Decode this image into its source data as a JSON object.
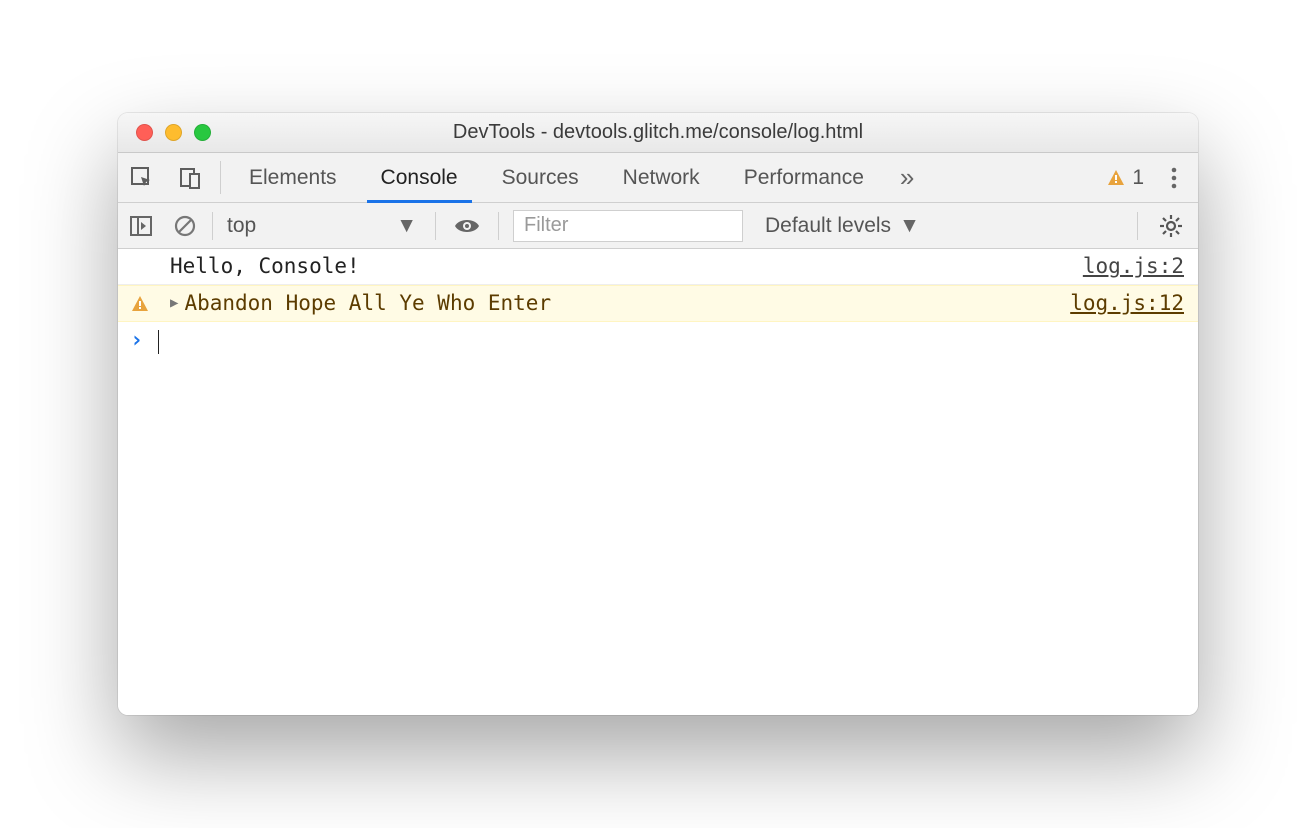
{
  "window": {
    "title": "DevTools - devtools.glitch.me/console/log.html"
  },
  "tabs": {
    "items": [
      "Elements",
      "Console",
      "Sources",
      "Network",
      "Performance"
    ],
    "active": "Console",
    "overflow_glyph": "»",
    "warning_count": "1"
  },
  "toolbar": {
    "context": "top",
    "filter_placeholder": "Filter",
    "levels_label": "Default levels"
  },
  "console": {
    "rows": [
      {
        "type": "log",
        "message": "Hello, Console!",
        "source": "log.js:2"
      },
      {
        "type": "warn",
        "message": "Abandon Hope All Ye Who Enter",
        "source": "log.js:12"
      }
    ],
    "prompt_glyph": "›"
  }
}
